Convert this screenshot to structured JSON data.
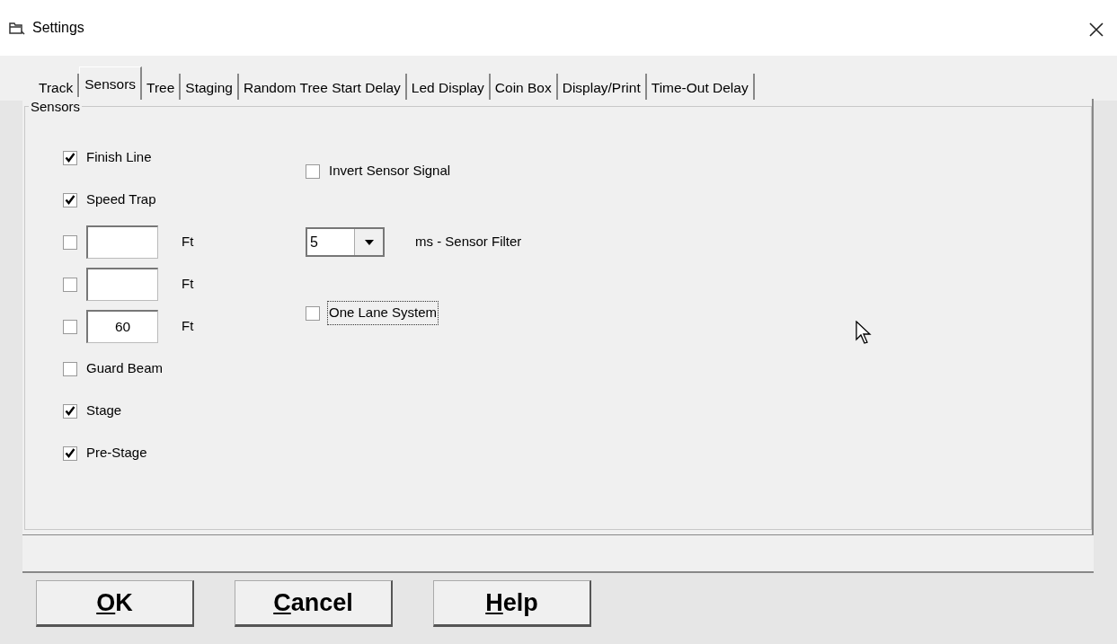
{
  "window": {
    "title": "Settings"
  },
  "tabs": [
    {
      "label": "Track",
      "selected": false
    },
    {
      "label": "Sensors",
      "selected": true
    },
    {
      "label": "Tree",
      "selected": false
    },
    {
      "label": "Staging",
      "selected": false
    },
    {
      "label": "Random Tree Start Delay",
      "selected": false
    },
    {
      "label": "Led Display",
      "selected": false
    },
    {
      "label": "Coin Box",
      "selected": false
    },
    {
      "label": "Display/Print",
      "selected": false
    },
    {
      "label": "Time-Out Delay",
      "selected": false
    }
  ],
  "group": {
    "title": "Sensors",
    "left": [
      {
        "kind": "check",
        "label": "Finish Line",
        "checked": true
      },
      {
        "kind": "check",
        "label": "Speed Trap",
        "checked": true
      },
      {
        "kind": "distance",
        "checked": false,
        "unit": "Ft"
      },
      {
        "kind": "distance",
        "checked": false,
        "unit": "Ft"
      },
      {
        "kind": "distance",
        "checked": false,
        "value": "60",
        "unit": "Ft"
      },
      {
        "kind": "check",
        "label": "Guard Beam",
        "checked": false
      },
      {
        "kind": "check",
        "label": "Stage",
        "checked": true
      },
      {
        "kind": "check",
        "label": "Pre-Stage",
        "checked": true
      }
    ],
    "right": [
      {
        "kind": "check",
        "label": "Invert Sensor Signal",
        "checked": false,
        "focused": false
      },
      {
        "kind": "combo",
        "value": "5",
        "label": "ms - Sensor Filter"
      },
      {
        "kind": "check",
        "label": "One Lane System",
        "checked": false,
        "focused": true
      }
    ]
  },
  "buttons": [
    {
      "accel": "O",
      "rest": "K"
    },
    {
      "accel": "C",
      "rest": "ancel"
    },
    {
      "accel": "H",
      "rest": "elp"
    }
  ]
}
